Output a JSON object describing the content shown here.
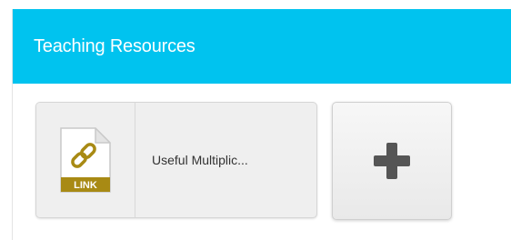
{
  "panel": {
    "title": "Teaching Resources"
  },
  "resources": [
    {
      "file_type": "LINK",
      "icon": "link-file-icon",
      "label": "Useful Multiplic..."
    }
  ],
  "add_button": {
    "icon": "plus-icon"
  },
  "colors": {
    "header_bg": "#00c3ef",
    "file_badge": "#a88a14",
    "icon_dark": "#555555"
  }
}
